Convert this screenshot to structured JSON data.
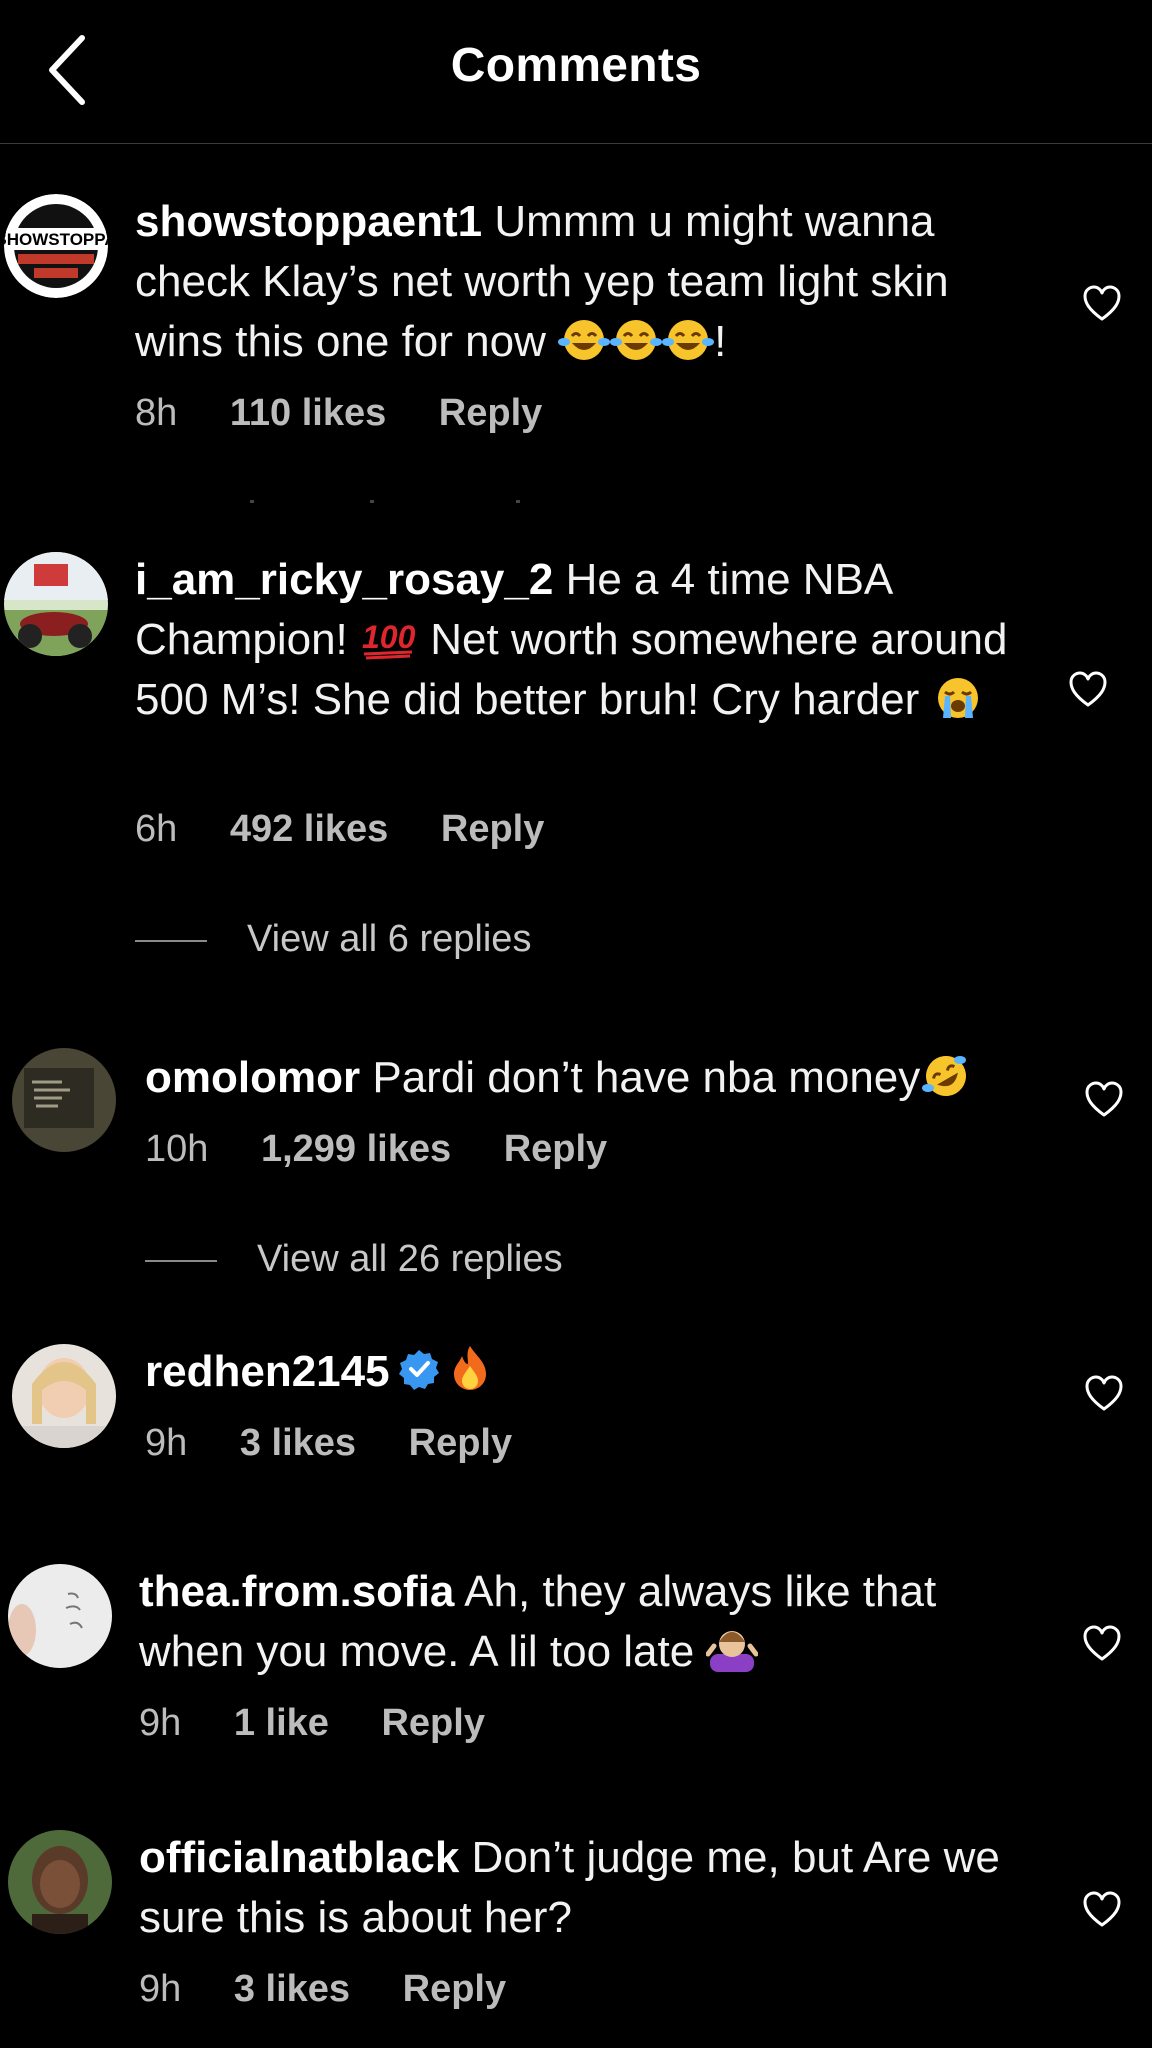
{
  "header": {
    "title": "Comments",
    "back_icon": "chevron-left-icon"
  },
  "comments": [
    {
      "username": "showstoppaent1",
      "text": "Ummm u might wanna check Klay’s net worth yep team light skin wins this one for now",
      "text_suffix": "!",
      "emojis": [
        "face-with-tears-of-joy-icon",
        "face-with-tears-of-joy-icon",
        "face-with-tears-of-joy-icon"
      ],
      "time": "8h",
      "likes": "110 likes",
      "reply": "Reply"
    },
    {
      "username": "i_am_ricky_rosay_2",
      "text_part1": "He a 4 time NBA Champion!",
      "text_part2": "Net worth somewhere around 500 M’s! She did better bruh! Cry harder",
      "emojis": [
        "hundred-points-icon",
        "loudly-crying-face-icon"
      ],
      "time": "6h",
      "likes": "492 likes",
      "reply": "Reply",
      "view_replies": "View all 6 replies"
    },
    {
      "username": "omolomor",
      "text": "Pardi don’t have nba money",
      "emojis": [
        "rolling-on-floor-laughing-icon"
      ],
      "time": "10h",
      "likes": "1,299 likes",
      "reply": "Reply",
      "view_replies": "View all 26 replies"
    },
    {
      "username": "redhen2145",
      "verified": true,
      "emojis": [
        "fire-icon"
      ],
      "time": "9h",
      "likes": "3 likes",
      "reply": "Reply"
    },
    {
      "username": "thea.from.sofia",
      "text": "Ah, they always like that when you move. A lil too late",
      "emojis": [
        "person-shrugging-icon"
      ],
      "time": "9h",
      "likes": "1 like",
      "reply": "Reply"
    },
    {
      "username": "officialnatblack",
      "text": "Don’t judge me, but Are we sure this is about her?",
      "time": "9h",
      "likes": "3 likes",
      "reply": "Reply"
    }
  ],
  "avatar_logo_text": "SHOWSTOPPA",
  "colors": {
    "background": "#000000",
    "text": "#ffffff",
    "meta": "#bcbcbc",
    "verified": "#3897f0"
  }
}
